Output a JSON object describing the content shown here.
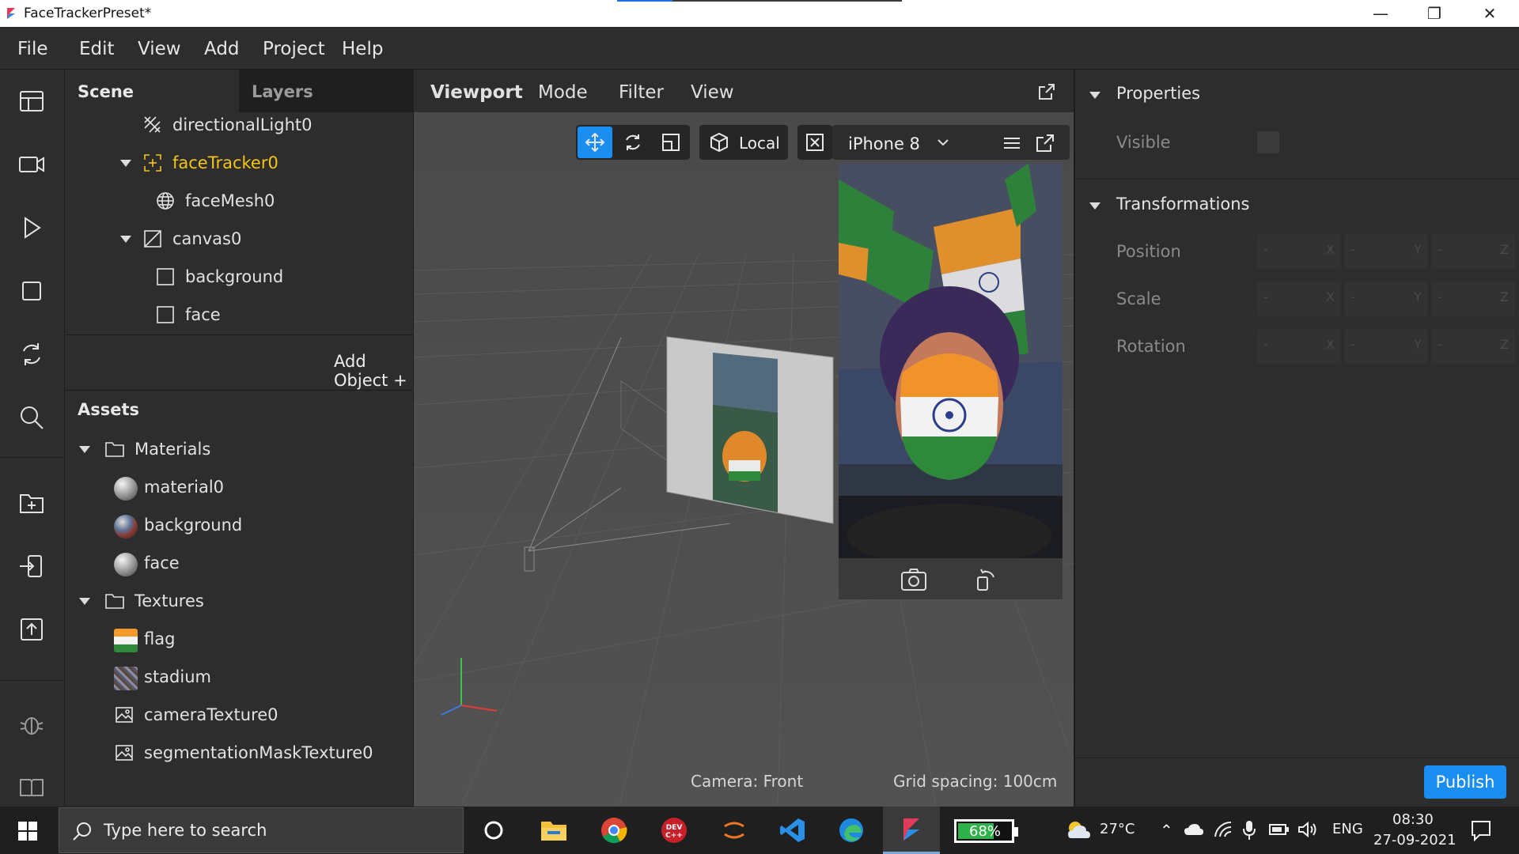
{
  "window": {
    "title": "FaceTrackerPreset*"
  },
  "menu": [
    "File",
    "Edit",
    "View",
    "Add",
    "Project",
    "Help"
  ],
  "sidebar_icons": [
    "layout-icon",
    "video-icon",
    "play-icon",
    "square-icon",
    "sync-icon",
    "search-icon",
    "add-folder-icon",
    "import-icon",
    "upload-icon",
    "bug-icon",
    "book-icon"
  ],
  "scene": {
    "tabs": [
      "Scene",
      "Layers"
    ],
    "items": [
      "directionalLight0",
      "faceTracker0",
      "faceMesh0",
      "canvas0",
      "background",
      "face"
    ],
    "add_object": "Add Object +"
  },
  "assets": {
    "title": "Assets",
    "folders": [
      "Materials",
      "Textures"
    ],
    "materials": [
      "material0",
      "background",
      "face"
    ],
    "textures": [
      "flag",
      "stadium",
      "cameraTexture0",
      "segmentationMaskTexture0"
    ]
  },
  "viewport": {
    "tabs": [
      "Viewport",
      "Mode",
      "Filter",
      "View"
    ],
    "space": "Local",
    "device": "iPhone 8",
    "camera": "Camera: Front",
    "grid": "Grid spacing: 100cm"
  },
  "properties": {
    "title": "Properties",
    "visible": "Visible",
    "transform_title": "Transformations",
    "rows": [
      "Position",
      "Scale",
      "Rotation"
    ],
    "axes": [
      "X",
      "Y",
      "Z"
    ],
    "placeholder": "-"
  },
  "publish": "Publish",
  "taskbar": {
    "search_placeholder": "Type here to search",
    "battery": "68%",
    "battery_level": 0.68,
    "weather": "27°C",
    "lang": "ENG",
    "time": "08:30",
    "date": "27-09-2021"
  },
  "colors": {
    "accent": "#1a8ef0",
    "selected": "#f5c518",
    "bg": "#2d2d2d",
    "viewport": "#4e4e4e"
  }
}
